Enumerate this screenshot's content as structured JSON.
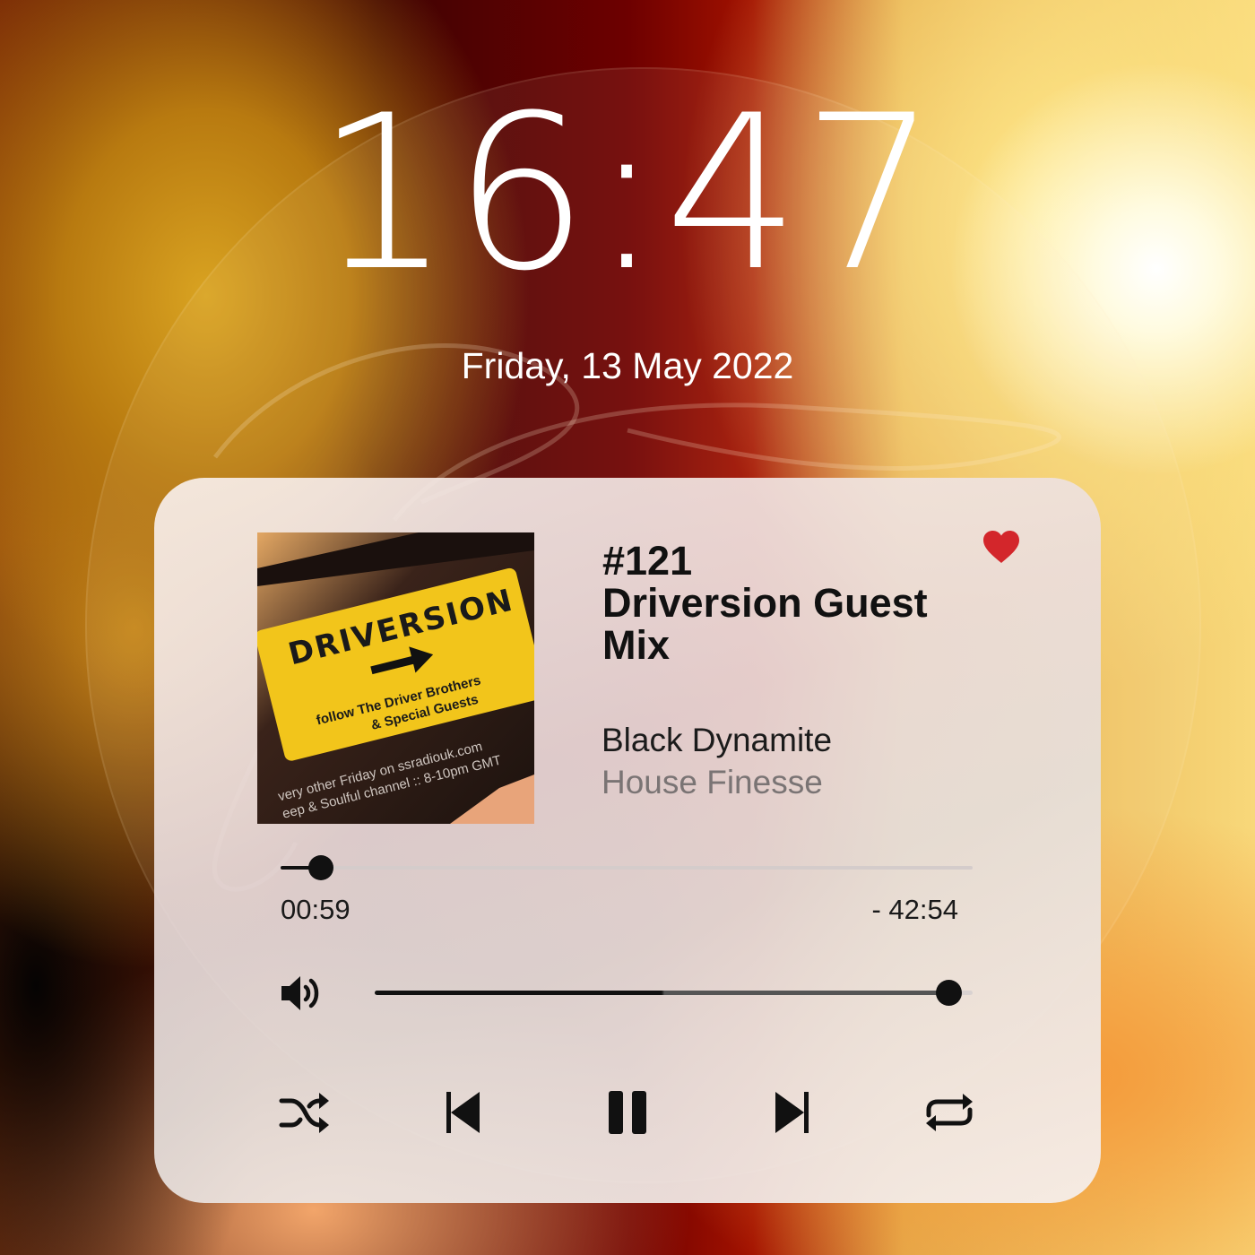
{
  "lockscreen": {
    "time": "16:47",
    "date": "Friday, 13 May 2022"
  },
  "player": {
    "cover": {
      "card_text": "DRIVERSION",
      "card_subtitle_1": "follow The Driver Brothers",
      "card_subtitle_2": "& Special Guests",
      "footer_1": "ssradiouk.com",
      "footer_2": "very other Friday on ssradiouk.com",
      "footer_3": "eep & Soulful channel :: 8-10pm GMT"
    },
    "track_number": "#121",
    "track_title": "Driversion Guest Mix",
    "artist": "Black Dynamite",
    "album": "House Finesse",
    "liked": true,
    "elapsed": "00:59",
    "remaining": "- 42:54",
    "progress_fraction": 0.058,
    "volume_fraction": 0.96,
    "controls": {
      "shuffle": "shuffle-icon",
      "previous": "previous-icon",
      "play_pause": "pause-icon",
      "next": "next-icon",
      "repeat": "repeat-icon"
    }
  },
  "colors": {
    "accent_heart": "#d3262b",
    "text_primary": "#111111",
    "text_secondary": "#7a7474"
  }
}
